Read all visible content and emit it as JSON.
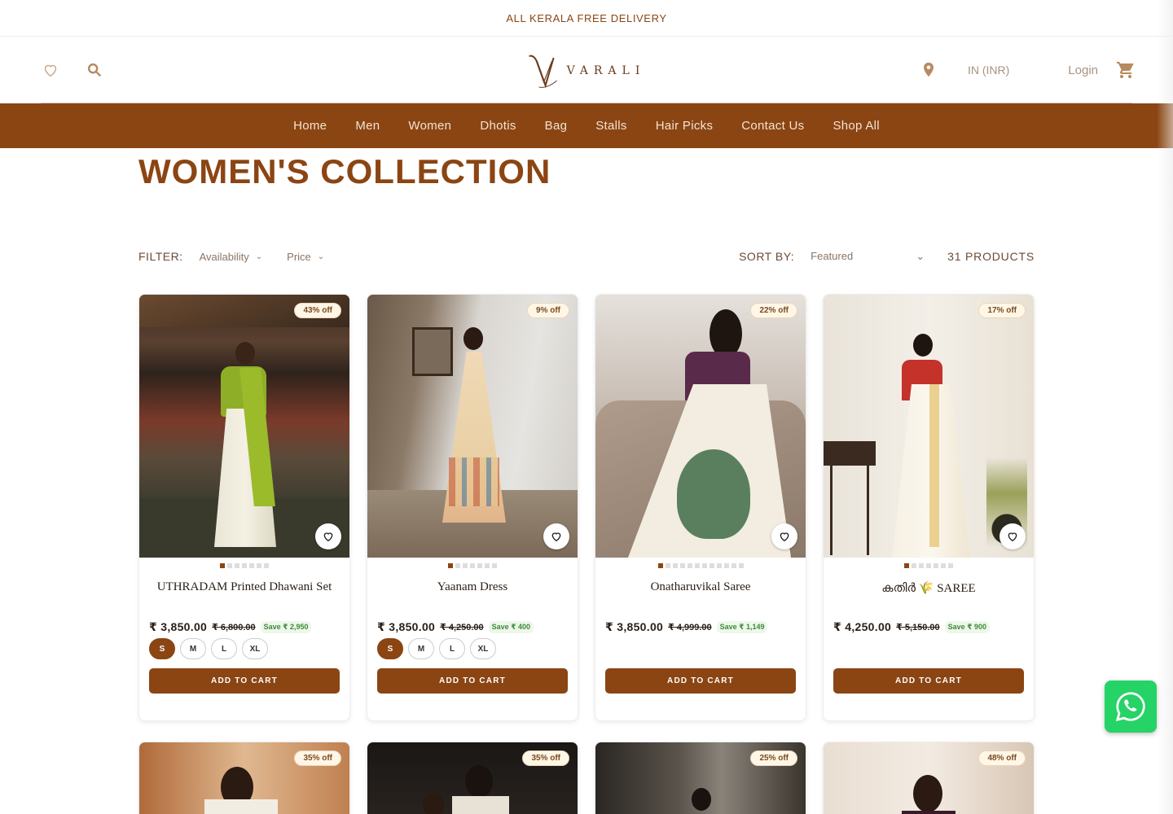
{
  "announcement": "ALL KERALA FREE DELIVERY",
  "header": {
    "logo_text": "VARALI",
    "currency": "IN (INR)",
    "login": "Login",
    "icons": [
      "heart-icon",
      "search-icon",
      "location-pin-icon",
      "cart-icon"
    ]
  },
  "nav": [
    "Home",
    "Men",
    "Women",
    "Dhotis",
    "Bag",
    "Stalls",
    "Hair Picks",
    "Contact Us",
    "Shop All"
  ],
  "page_title": "WOMEN'S COLLECTION",
  "filter": {
    "label": "FILTER:",
    "availability": "Availability",
    "price": "Price",
    "sort_label": "SORT BY:",
    "sort_value": "Featured",
    "count": "31 PRODUCTS"
  },
  "add_to_cart": "ADD TO CART",
  "products": [
    {
      "name": "UTHRADAM Printed Dhawani Set",
      "badge": "43% off",
      "price": "₹ 3,850.00",
      "old_price": "₹ 6,800.00",
      "save": "Save ₹ 2,950",
      "sizes": [
        "S",
        "M",
        "L",
        "XL"
      ],
      "selected_size": "S",
      "image_dots": 7
    },
    {
      "name": "Yaanam Dress",
      "badge": "9% off",
      "price": "₹ 3,850.00",
      "old_price": "₹ 4,250.00",
      "save": "Save ₹ 400",
      "sizes": [
        "S",
        "M",
        "L",
        "XL"
      ],
      "selected_size": "S",
      "image_dots": 7
    },
    {
      "name": "Onatharuvikal Saree",
      "badge": "22% off",
      "price": "₹ 3,850.00",
      "old_price": "₹ 4,999.00",
      "save": "Save ₹ 1,149",
      "sizes": [],
      "image_dots": 12
    },
    {
      "name": "കതിർ 🌾 SAREE",
      "badge": "17% off",
      "price": "₹ 4,250.00",
      "old_price": "₹ 5,150.00",
      "save": "Save ₹ 900",
      "sizes": [],
      "image_dots": 7
    }
  ],
  "products_row2_badges": [
    "35% off",
    "35% off",
    "25% off",
    "48% off"
  ],
  "colors": {
    "brand": "#8b4513",
    "whatsapp": "#25d366"
  }
}
